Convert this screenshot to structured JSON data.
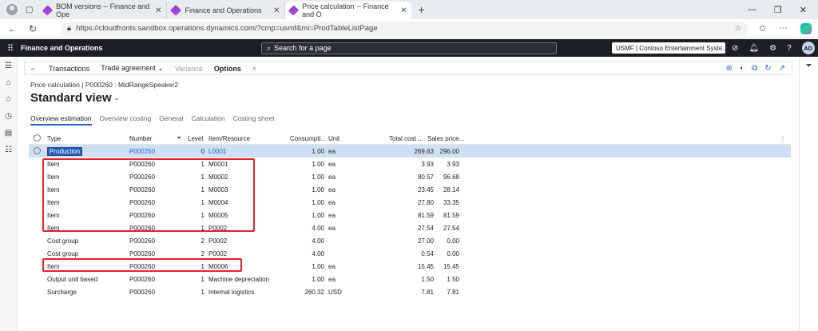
{
  "browser": {
    "tabs": [
      {
        "title": "BOM versions -- Finance and Ope",
        "active": false
      },
      {
        "title": "Finance and Operations",
        "active": false
      },
      {
        "title": "Price calculation -- Finance and O",
        "active": true
      }
    ],
    "url": "https://cloudfronts.sandbox.operations.dynamics.com/?cmp=usmf&mi=ProdTableListPage"
  },
  "appbar": {
    "app_name": "Finance and Operations",
    "search_placeholder": "Search for a page",
    "company": "USMF | Contoso Entertainment Syste...",
    "avatar_initials": "AD"
  },
  "actionpane": {
    "transactions": "Transactions",
    "trade_agreement": "Trade agreement",
    "variance": "Variance",
    "options": "Options"
  },
  "page": {
    "breadcrumb": "Price calculation  |  P000260 : MidRangeSpeaker2",
    "title": "Standard view",
    "tabs": [
      "Overview estimation",
      "Overview costing",
      "General",
      "Calculation",
      "Costing sheet"
    ],
    "active_tab": 0
  },
  "grid": {
    "headers": {
      "type": "Type",
      "number": "Number",
      "level": "Level",
      "item": "Item/Resource",
      "consumption": "Consumpti...",
      "unit": "Unit",
      "total_cost": "Total cost ...",
      "sales_price": "Sales price..."
    },
    "rows": [
      {
        "type": "Production",
        "number": "P000260",
        "level": "0",
        "item": "L0001",
        "consumption": "1.00",
        "unit": "ea",
        "total_cost": "269.63",
        "sales_price": "296.00"
      },
      {
        "type": "Item",
        "number": "P000260",
        "level": "1",
        "item": "M0001",
        "consumption": "1.00",
        "unit": "ea",
        "total_cost": "3.93",
        "sales_price": "3.93"
      },
      {
        "type": "Item",
        "number": "P000260",
        "level": "1",
        "item": "M0002",
        "consumption": "1.00",
        "unit": "ea",
        "total_cost": "80.57",
        "sales_price": "96.68"
      },
      {
        "type": "Item",
        "number": "P000260",
        "level": "1",
        "item": "M0003",
        "consumption": "1.00",
        "unit": "ea",
        "total_cost": "23.45",
        "sales_price": "28.14"
      },
      {
        "type": "Item",
        "number": "P000260",
        "level": "1",
        "item": "M0004",
        "consumption": "1.00",
        "unit": "ea",
        "total_cost": "27.80",
        "sales_price": "33.35"
      },
      {
        "type": "Item",
        "number": "P000260",
        "level": "1",
        "item": "M0005",
        "consumption": "1.00",
        "unit": "ea",
        "total_cost": "81.59",
        "sales_price": "81.59"
      },
      {
        "type": "Item",
        "number": "P000260",
        "level": "1",
        "item": "P0002",
        "consumption": "4.00",
        "unit": "ea",
        "total_cost": "27.54",
        "sales_price": "27.54"
      },
      {
        "type": "Cost group",
        "number": "P000260",
        "level": "2",
        "item": "P0002",
        "consumption": "4.00",
        "unit": "",
        "total_cost": "27.00",
        "sales_price": "0.00"
      },
      {
        "type": "Cost group",
        "number": "P000260",
        "level": "2",
        "item": "P0002",
        "consumption": "4.00",
        "unit": "",
        "total_cost": "0.54",
        "sales_price": "0.00"
      },
      {
        "type": "Item",
        "number": "P000260",
        "level": "1",
        "item": "M0006",
        "consumption": "1.00",
        "unit": "ea",
        "total_cost": "15.45",
        "sales_price": "15.45"
      },
      {
        "type": "Output unit based",
        "number": "P000260",
        "level": "1",
        "item": "Machine depreciation",
        "consumption": "1.00",
        "unit": "ea",
        "total_cost": "1.50",
        "sales_price": "1.50"
      },
      {
        "type": "Surcharge",
        "number": "P000260",
        "level": "1",
        "item": "Internal logistics",
        "consumption": "260.32",
        "unit": "USD",
        "total_cost": "7.81",
        "sales_price": "7.81"
      }
    ]
  },
  "annotation_color": "#e8222e",
  "accent_color": "#2a64c5"
}
